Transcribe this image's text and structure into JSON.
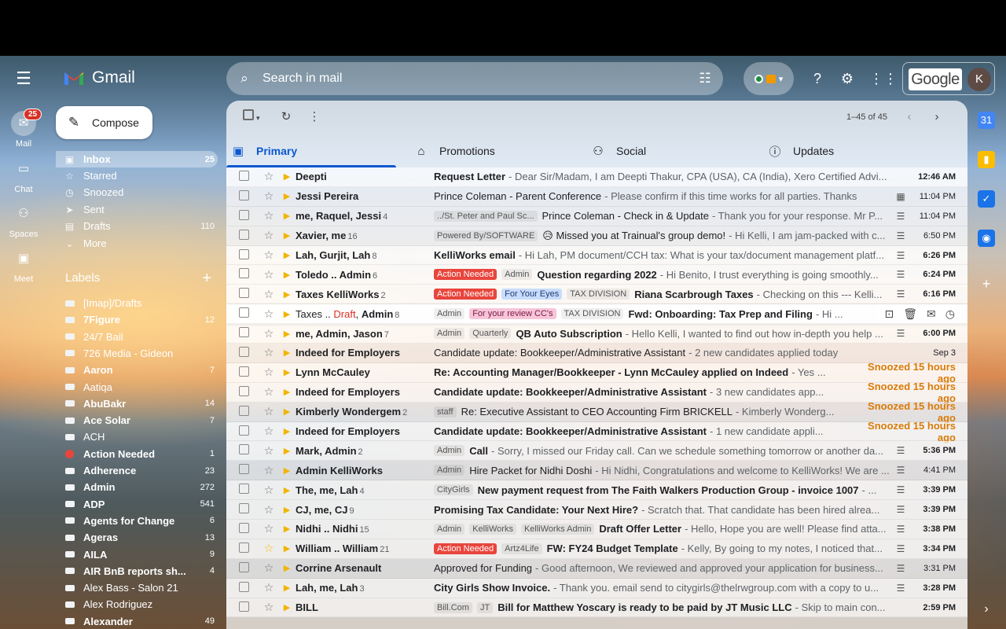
{
  "app": {
    "name": "Gmail"
  },
  "search": {
    "placeholder": "Search in mail"
  },
  "account": {
    "brand": "Google",
    "avatar_letter": "K"
  },
  "rail": [
    {
      "label": "Mail",
      "badge": "25",
      "icon": "mail-icon"
    },
    {
      "label": "Chat",
      "icon": "chat-icon"
    },
    {
      "label": "Spaces",
      "icon": "spaces-icon"
    },
    {
      "label": "Meet",
      "icon": "meet-icon"
    }
  ],
  "compose_label": "Compose",
  "folders": [
    {
      "label": "Inbox",
      "count": "25",
      "icon": "inbox-icon"
    },
    {
      "label": "Starred",
      "count": "",
      "icon": "star-icon"
    },
    {
      "label": "Snoozed",
      "count": "",
      "icon": "clock-icon"
    },
    {
      "label": "Sent",
      "count": "",
      "icon": "send-icon"
    },
    {
      "label": "Drafts",
      "count": "110",
      "icon": "draft-icon"
    },
    {
      "label": "More",
      "count": "",
      "icon": "chevron-down-icon"
    }
  ],
  "labels_heading": "Labels",
  "labels": [
    {
      "label": "[Imap]/Drafts",
      "count": "",
      "bold": false
    },
    {
      "label": "7Figure",
      "count": "12",
      "bold": true
    },
    {
      "label": "24/7 Bail",
      "count": "",
      "bold": false
    },
    {
      "label": "726 Media - Gideon",
      "count": "",
      "bold": false
    },
    {
      "label": "Aaron",
      "count": "7",
      "bold": true
    },
    {
      "label": "Aatiqa",
      "count": "",
      "bold": false
    },
    {
      "label": "AbuBakr",
      "count": "14",
      "bold": true
    },
    {
      "label": "Ace Solar",
      "count": "7",
      "bold": true
    },
    {
      "label": "ACH",
      "count": "",
      "bold": false
    },
    {
      "label": "Action Needed",
      "count": "1",
      "bold": true,
      "red": true
    },
    {
      "label": "Adherence",
      "count": "23",
      "bold": true
    },
    {
      "label": "Admin",
      "count": "272",
      "bold": true
    },
    {
      "label": "ADP",
      "count": "541",
      "bold": true
    },
    {
      "label": "Agents for Change",
      "count": "6",
      "bold": true
    },
    {
      "label": "Ageras",
      "count": "13",
      "bold": true
    },
    {
      "label": "AILA",
      "count": "9",
      "bold": true
    },
    {
      "label": "AIR BnB reports sh...",
      "count": "4",
      "bold": true
    },
    {
      "label": "Alex Bass - Salon 21",
      "count": "",
      "bold": false
    },
    {
      "label": "Alex Rodriguez",
      "count": "",
      "bold": false
    },
    {
      "label": "Alexander",
      "count": "49",
      "bold": true
    }
  ],
  "pager": "1–45 of 45",
  "tabs": [
    {
      "label": "Primary",
      "icon": "inbox-tab-icon"
    },
    {
      "label": "Promotions",
      "icon": "tag-icon"
    },
    {
      "label": "Social",
      "icon": "people-icon"
    },
    {
      "label": "Updates",
      "icon": "info-icon"
    }
  ],
  "emails": [
    {
      "unread": true,
      "sender": "Deepti",
      "count": "",
      "chips": [],
      "subject": "Request Letter",
      "snippet": " - Dear Sir/Madam, I am Deepti Thakur, CPA (USA), CA (India), Xero Certified Advi...",
      "attach": "",
      "date": "12:46 AM"
    },
    {
      "unread": false,
      "sender": "Jessi Pereira",
      "count": "",
      "chips": [],
      "subject": "Prince Coleman - Parent Conference",
      "snippet": " - Please confirm if this time works for all parties. Thanks",
      "attach": "calendar",
      "date": "11:04 PM"
    },
    {
      "unread": false,
      "sender": "me, Raquel, Jessi",
      "count": "4",
      "chips": [
        {
          "t": "../St. Peter and Paul Sc...",
          "c": "plain"
        }
      ],
      "subject": "Prince Coleman - Check in & Update",
      "snippet": " - Thank you for your response. Mr P...",
      "attach": "chat",
      "date": "11:04 PM"
    },
    {
      "unread": false,
      "sender": "Xavier, me",
      "count": "16",
      "chips": [
        {
          "t": "Powered By/SOFTWARE",
          "c": "plain"
        }
      ],
      "subject": "😥 Missed you at Trainual's group demo!",
      "snippet": " - Hi Kelli, I am jam-packed with c...",
      "attach": "chat",
      "date": "6:50 PM"
    },
    {
      "unread": true,
      "sender": "Lah, Gurjit, Lah",
      "count": "8",
      "chips": [],
      "subject": "KelliWorks email",
      "snippet": " - Hi Lah, PM document/CCH tax: What is your tax/document management platf...",
      "attach": "chat",
      "date": "6:26 PM"
    },
    {
      "unread": true,
      "sender": "Toledo .. Admin",
      "count": "6",
      "chips": [
        {
          "t": "Action Needed",
          "c": "red"
        },
        {
          "t": "Admin",
          "c": "plain"
        }
      ],
      "subject": "Question regarding 2022",
      "snippet": " - Hi Benito, I trust everything is going smoothly...",
      "attach": "chat",
      "date": "6:24 PM"
    },
    {
      "unread": true,
      "sender": "Taxes KelliWorks",
      "count": "2",
      "chips": [
        {
          "t": "Action Needed",
          "c": "red"
        },
        {
          "t": "For Your Eyes",
          "c": "blue"
        },
        {
          "t": "TAX DIVISION",
          "c": "plain"
        }
      ],
      "subject": "Riana Scarbrough Taxes",
      "snippet": " - Checking on this --- Kelli...",
      "attach": "chat",
      "date": "6:16 PM"
    },
    {
      "unread": true,
      "hover": true,
      "sender": "Taxes .. Draft, Admin",
      "draft": true,
      "count": "8",
      "chips": [
        {
          "t": "Admin",
          "c": "plain"
        },
        {
          "t": "For your review CC's",
          "c": "pink"
        },
        {
          "t": "TAX DIVISION",
          "c": "plain"
        }
      ],
      "subject": "Fwd: Onboarding: Tax Prep and Filing",
      "snippet": " - Hi ...",
      "attach": "",
      "date": ""
    },
    {
      "unread": true,
      "sender": "me, Admin, Jason",
      "count": "7",
      "chips": [
        {
          "t": "Admin",
          "c": "plain"
        },
        {
          "t": "Quarterly",
          "c": "plain"
        }
      ],
      "subject": "QB Auto Subscription",
      "snippet": " - Hello Kelli, I wanted to find out how in-depth you help ...",
      "attach": "chat",
      "date": "6:00 PM"
    },
    {
      "unread": false,
      "sender": "Indeed for Employers",
      "count": "",
      "chips": [],
      "subject": "Candidate update: Bookkeeper/Administrative Assistant",
      "snippet": " - 2 new candidates applied today",
      "attach": "",
      "date": "Sep 3"
    },
    {
      "unread": true,
      "sender": "Lynn McCauley",
      "count": "",
      "chips": [],
      "subject": "Re: Accounting Manager/Bookkeeper - Lynn McCauley applied on Indeed",
      "snippet": " - Yes ...",
      "attach": "",
      "date": "Snoozed 15 hours ago",
      "snoozed": true
    },
    {
      "unread": true,
      "sender": "Indeed for Employers",
      "count": "",
      "chips": [],
      "subject": "Candidate update: Bookkeeper/Administrative Assistant",
      "snippet": " - 3 new candidates app...",
      "attach": "",
      "date": "Snoozed 15 hours ago",
      "snoozed": true
    },
    {
      "unread": false,
      "sender": "Kimberly Wondergem",
      "count": "2",
      "chips": [
        {
          "t": "staff",
          "c": "plain"
        }
      ],
      "subject": "Re: Executive Assistant to CEO Accounting Firm BRICKELL",
      "snippet": " - Kimberly Wonderg...",
      "attach": "",
      "date": "Snoozed 15 hours ago",
      "snoozed": true
    },
    {
      "unread": true,
      "sender": "Indeed for Employers",
      "count": "",
      "chips": [],
      "subject": "Candidate update: Bookkeeper/Administrative Assistant",
      "snippet": " - 1 new candidate appli...",
      "attach": "",
      "date": "Snoozed 15 hours ago",
      "snoozed": true
    },
    {
      "unread": true,
      "sender": "Mark, Admin",
      "count": "2",
      "chips": [
        {
          "t": "Admin",
          "c": "plain"
        }
      ],
      "subject": "Call",
      "snippet": " - Sorry, I missed our Friday call. Can we schedule something tomorrow or another da...",
      "attach": "chat",
      "date": "5:36 PM"
    },
    {
      "unread": false,
      "sender": "Admin KelliWorks",
      "count": "",
      "chips": [
        {
          "t": "Admin",
          "c": "plain"
        }
      ],
      "subject": "Hire Packet for Nidhi Doshi",
      "snippet": " - Hi Nidhi, Congratulations and welcome to KelliWorks! We are ...",
      "attach": "chat",
      "date": "4:41 PM"
    },
    {
      "unread": true,
      "sender": "The, me, Lah",
      "count": "4",
      "chips": [
        {
          "t": "CityGirls",
          "c": "plain"
        }
      ],
      "subject": "New payment request from The Faith Walkers Production Group - invoice 1007",
      "snippet": " - ...",
      "attach": "chat",
      "date": "3:39 PM"
    },
    {
      "unread": true,
      "sender": "CJ, me, CJ",
      "count": "9",
      "chips": [],
      "subject": "Promising Tax Candidate: Your Next Hire?",
      "snippet": " - Scratch that. That candidate has been hired alrea...",
      "attach": "chat",
      "date": "3:39 PM"
    },
    {
      "unread": true,
      "sender": "Nidhi .. Nidhi",
      "count": "15",
      "chips": [
        {
          "t": "Admin",
          "c": "plain"
        },
        {
          "t": "KelliWorks",
          "c": "plain"
        },
        {
          "t": "KelliWorks Admin",
          "c": "plain"
        }
      ],
      "subject": "Draft Offer Letter",
      "snippet": " - Hello, Hope you are well! Please find atta...",
      "attach": "chat",
      "date": "3:38 PM"
    },
    {
      "unread": true,
      "sender": "William .. William",
      "count": "21",
      "starred": true,
      "chips": [
        {
          "t": "Action Needed",
          "c": "red"
        },
        {
          "t": "Artz4Life",
          "c": "plain"
        }
      ],
      "subject": "FW: FY24 Budget Template",
      "snippet": " - Kelly, By going to my notes, I noticed that...",
      "attach": "chat",
      "date": "3:34 PM"
    },
    {
      "unread": false,
      "sender": "Corrine Arsenault",
      "count": "",
      "chips": [],
      "subject": "Approved for Funding",
      "snippet": " - Good afternoon, We reviewed and approved your application for business...",
      "attach": "chat",
      "date": "3:31 PM"
    },
    {
      "unread": true,
      "sender": "Lah, me, Lah",
      "count": "3",
      "chips": [],
      "subject": "City Girls Show Invoice.",
      "snippet": " - Thank you. email send to citygirls@thelrwgroup.com with a copy to u...",
      "attach": "chat",
      "date": "3:28 PM"
    },
    {
      "unread": true,
      "sender": "BILL",
      "count": "",
      "chips": [
        {
          "t": "Bill.Com",
          "c": "plain"
        },
        {
          "t": "JT",
          "c": "plain"
        }
      ],
      "subject": "Bill for Matthew Yoscary is ready to be paid by JT Music LLC",
      "snippet": " - Skip to main con...",
      "attach": "",
      "date": "2:59 PM"
    }
  ],
  "colors": {
    "accent": "#0b57d0",
    "action_needed": "#e8453c",
    "snoozed": "#d97b08",
    "important": "#f2b400"
  }
}
